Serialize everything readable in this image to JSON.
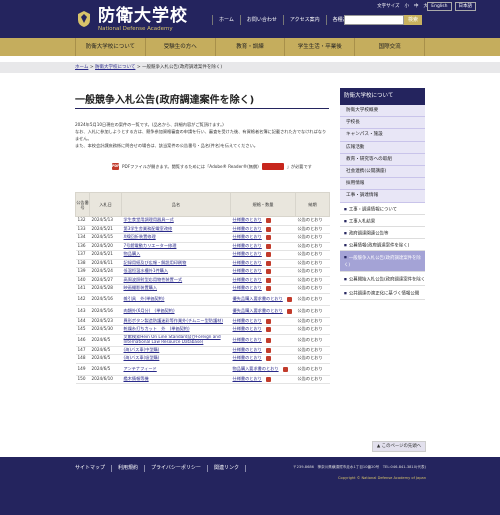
{
  "header": {
    "logo_title": "防衛大学校",
    "logo_sub": "National Defense Academy",
    "util_links": [
      "文字サイズ",
      "小",
      "中",
      "大"
    ],
    "lang_links": [
      "English",
      "日本語"
    ],
    "nav": [
      "ホーム",
      "お問い合わせ",
      "アクセス案内",
      "各種お問合せ"
    ],
    "search_placeholder": "",
    "search_button": "検索"
  },
  "gold_nav": [
    "防衛大学校について",
    "受験生の方へ",
    "教育・訓練",
    "学生生活・卒業後",
    "国際交流"
  ],
  "breadcrumb": {
    "items": [
      "ホーム",
      "防衛大学校について",
      "一般競争入札公告(政府調達案件を除く)"
    ],
    "sep": ">"
  },
  "main": {
    "title": "一般競争入札公告(政府調達案件を除く)",
    "intro": [
      "2024年5月10日現在の案件の一覧です。(品名から、詳細内容がご覧頂けます。)",
      "なお、入札に参加しようとする方は、競争参加資格審査の申請を行い、審査を受けた後、有資格者名簿に記載された方でなければなりません。",
      "また、本校会計課庶務係に問合せの場合は、該当案件の公告番号・品名(件名)を伝えてください。"
    ],
    "pdf_note_before": "PDFファイルが開きます。閲覧するためには「Adobe® Reader®(無償)",
    "pdf_note_after": "」が必要です"
  },
  "table": {
    "headers": [
      "公告番号",
      "入札日",
      "品名",
      "規格・数量",
      "納期"
    ],
    "rows": [
      {
        "no": "132",
        "date": "2024/5/13",
        "name": "学生食堂用調理用器具一式",
        "spec": "仕様書のとおり",
        "note": "公告のとおり"
      },
      {
        "no": "133",
        "date": "2024/5/21",
        "name": "第3学生舎業務配電室改修",
        "spec": "仕様書のとおり",
        "note": "公告のとおり"
      },
      {
        "no": "134",
        "date": "2024/5/15",
        "name": "X線回折装置修理",
        "spec": "仕様書のとおり",
        "note": "公告のとおり"
      },
      {
        "no": "136",
        "date": "2024/5/20",
        "name": "7号館電動カリエーター修理",
        "spec": "仕様書のとおり",
        "note": "公告のとおり"
      },
      {
        "no": "137",
        "date": "2024/5/21",
        "name": "物品購入",
        "spec": "仕様書のとおり",
        "note": "公告のとおり"
      },
      {
        "no": "138",
        "date": "2024/6/11",
        "name": "記録用紙及び広報・解説用印刷物",
        "spec": "仕様書のとおり",
        "note": "公告のとおり"
      },
      {
        "no": "139",
        "date": "2024/5/24",
        "name": "低温恒温水槽外1件購入",
        "spec": "仕様書のとおり",
        "note": "公告のとおり"
      },
      {
        "no": "140",
        "date": "2024/5/27",
        "name": "高周波照射型応用物性装置一式",
        "spec": "仕様書のとおり",
        "note": "公告のとおり"
      },
      {
        "no": "141",
        "date": "2024/5/28",
        "name": "映画撮影装置購入",
        "spec": "仕様書のとおり",
        "note": "公告のとおり"
      },
      {
        "no": "142",
        "date": "2024/5/16",
        "name": "雑引具　外(単価契約)",
        "spec": "優先品購入要求書のとおり",
        "note": "公告のとおり",
        "tall": true
      },
      {
        "no": "143",
        "date": "2024/5/16",
        "name": "肉類外(6月分)　(単価契約)",
        "spec": "優先品購入要求書のとおり",
        "note": "公告のとおり",
        "tall": true
      },
      {
        "no": "144",
        "date": "2024/5/23",
        "name": "異形ボタン製造防護迷彩等作業外(チムニー型防護材)",
        "spec": "仕様書のとおり",
        "note": "公告のとおり"
      },
      {
        "no": "145",
        "date": "2024/5/30",
        "name": "乾燥糸打ちカット　外　(単価契約)",
        "spec": "仕様書のとおり",
        "note": "公告のとおり"
      },
      {
        "no": "146",
        "date": "2024/6/5",
        "name": "文献検索Hein On Line Standard及びForeign and International Law Resource Database)",
        "spec": "仕様書のとおり",
        "note": "公告のとおり",
        "tall": true
      },
      {
        "no": "147",
        "date": "2024/6/5",
        "name": "(海)バス車(中型購)",
        "spec": "仕様書のとおり",
        "note": "公告のとおり"
      },
      {
        "no": "148",
        "date": "2024/6/5",
        "name": "(海)バス車(吸型購)",
        "spec": "仕様書のとおり",
        "note": "公告のとおり"
      },
      {
        "no": "149",
        "date": "2024/6/5",
        "name": "アンテナフィード",
        "spec": "物品購入要求書のとおり",
        "note": "公告のとおり",
        "tall": true
      },
      {
        "no": "150",
        "date": "2024/6/10",
        "name": "艦木情報等機",
        "spec": "仕様書のとおり",
        "note": "公告のとおり"
      }
    ]
  },
  "sidebar": {
    "head": "防衛大学校について",
    "items": [
      "防衛大学校概要",
      "学校長",
      "キャンパス・施設",
      "広報活動",
      "教育・研究等への取組",
      "社会連携(公開講座)",
      "採用情報",
      "工事・調達情報"
    ],
    "subs": [
      "工事・調達情報について",
      "工事入札結果",
      "政府調達関連公告等",
      "公募情報(政府調達案件を除く)",
      "一般競争入札公告(政府調達案件を除く)",
      "公募開始入札公告(政府調達案件を除く)",
      "公共調達の適正化に基づく情報公開"
    ],
    "active_index": 4
  },
  "page_top": "このページの先頭へ",
  "footer": {
    "links": [
      "サイトマップ",
      "利用規約",
      "プライバシーポリシー",
      "関連リンク"
    ],
    "address": "〒239-8686　神奈川県横須賀市走水1丁目10番20号　TEL:046-841-3810(代表)",
    "copyright": "Copyright © National Defense Academy of Japan"
  },
  "colors": {
    "navy": "#24245e",
    "gold": "#c5ad5d",
    "side_active": "#a4a3d6"
  }
}
